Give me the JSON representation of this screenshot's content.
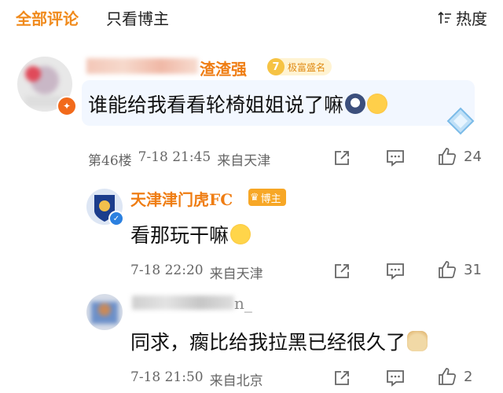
{
  "tabs": {
    "all": "全部评论",
    "blogger_only": "只看博主"
  },
  "sort": {
    "label": "热度",
    "icon": "sort-icon"
  },
  "comments": [
    {
      "username": "渣渣强",
      "fame": {
        "level": "7",
        "label": "极富盛名"
      },
      "text": "谁能给我看看轮椅姐姐说了嘛",
      "floor": "第46楼",
      "time": "7-18 21:45",
      "location": "来自天津",
      "likes": "24"
    },
    {
      "username": "天津津门虎FC",
      "tag": "博主",
      "text": "看那玩干嘛",
      "time": "7-18 22:20",
      "location": "来自天津",
      "likes": "31"
    },
    {
      "username": "n_",
      "text": "同求，瘸比给我拉黑已经很久了",
      "time": "7-18 21:50",
      "location": "来自北京",
      "likes": "2"
    }
  ],
  "colors": {
    "accent": "#f08a1c",
    "username": "#ef7d13",
    "meta": "#666666"
  }
}
